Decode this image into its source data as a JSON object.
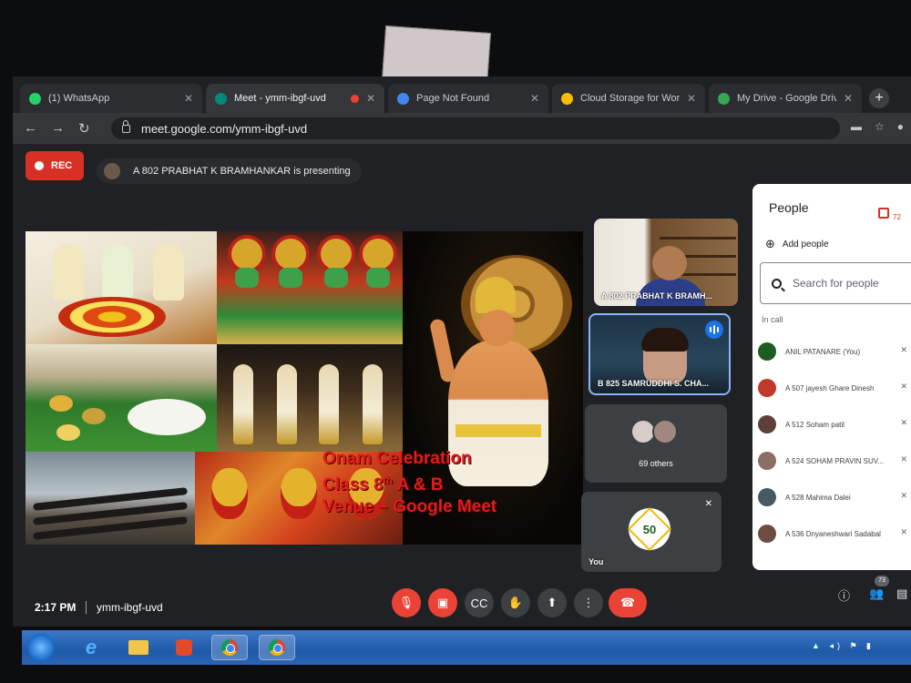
{
  "browser": {
    "tabs": [
      {
        "title": "(1) WhatsApp",
        "favicon_color": "#25d366",
        "active": false
      },
      {
        "title": "Meet - ymm-ibgf-uvd",
        "favicon_color": "#00897b",
        "active": true,
        "recording": true
      },
      {
        "title": "Page Not Found",
        "favicon_color": "#4285f4",
        "active": false
      },
      {
        "title": "Cloud Storage for Work and H",
        "favicon_color": "#fbbc04",
        "active": false
      },
      {
        "title": "My Drive - Google Drive",
        "favicon_color": "#34a853",
        "active": false
      }
    ],
    "new_tab_label": "+",
    "url": "meet.google.com/ymm-ibgf-uvd"
  },
  "meet": {
    "rec_label": "REC",
    "presenting_text": "A 802 PRABHAT K BRAMHANKAR is presenting",
    "slide": {
      "line1": "Onam Celebration",
      "line2_prefix": "Class 8",
      "line2_sup": "th",
      "line2_suffix": " A & B",
      "line3": "Venue – Google Meet"
    },
    "tiles": {
      "t1_name": "A 802 PRABHAT K BRAMH...",
      "t2_name": "B 825 SAMRUDDHI S. CHA...",
      "t3_label": "69 others",
      "t4_label": "You",
      "logo_text": "50"
    },
    "clock": "2:17 PM",
    "meeting_code": "ymm-ibgf-uvd",
    "participant_count": "73"
  },
  "people": {
    "title": "People",
    "badge_count": "72",
    "add_people": "Add people",
    "search_placeholder": "Search for people",
    "in_call_label": "In call",
    "list": [
      {
        "name": "ANIL PATANARE (You)",
        "avatar_color": "#1b5e20"
      },
      {
        "name": "A 507 jayesh Ghare Dinesh",
        "avatar_color": "#c0392b"
      },
      {
        "name": "A 512 Soham patil",
        "avatar_color": "#5d4037"
      },
      {
        "name": "A 524 SOHAM PRAVIN SUV...",
        "avatar_color": "#8d6e63"
      },
      {
        "name": "A 528 Mahima Dalei",
        "avatar_color": "#455a64"
      },
      {
        "name": "A 536 Dnyaneshwari Sadabal",
        "avatar_color": "#6d4c41"
      }
    ]
  },
  "colors": {
    "accent_blue": "#8ab4f8",
    "danger_red": "#ea4335",
    "meet_bg": "#202124"
  }
}
